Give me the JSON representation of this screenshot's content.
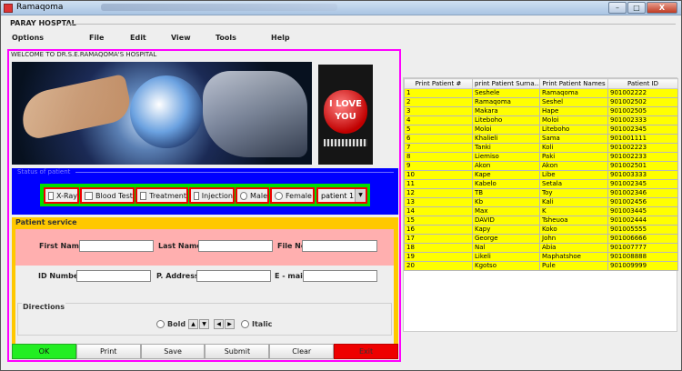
{
  "window": {
    "title": "Ramaqoma",
    "buttons": {
      "minimize": "–",
      "maximize": "□",
      "close": "X"
    }
  },
  "frame": {
    "title": "PARAY HOSPTAL"
  },
  "menu": [
    "Options",
    "File",
    "Edit",
    "View",
    "Tools",
    "Help"
  ],
  "welcome": "WELCOME TO DR.S.E.RAMAQOMA'S HOSPITAL",
  "banner": {
    "heart_top": "I LOVE",
    "heart_bottom": "YOU"
  },
  "status": {
    "legend": "Status of patient",
    "options": [
      {
        "kind": "checkbox",
        "label": "X-Ray"
      },
      {
        "kind": "checkbox",
        "label": "Blood Test"
      },
      {
        "kind": "checkbox",
        "label": "Treatment"
      },
      {
        "kind": "checkbox",
        "label": "Injection"
      },
      {
        "kind": "radio",
        "label": "Male"
      },
      {
        "kind": "radio",
        "label": "Female"
      }
    ],
    "combo_value": "patient 1"
  },
  "service": {
    "title": "Patient service",
    "labels": {
      "first_name": "First Name",
      "last_name": "Last Name",
      "file_no": "File No",
      "id_number": "ID Number",
      "p_address": "P. Address",
      "email": "E - mail"
    },
    "directions": {
      "label": "Directions",
      "bold": "Bold",
      "italic": "Italic"
    }
  },
  "buttons": [
    "OK",
    "Print",
    "Save",
    "Submit",
    "Clear",
    "Exit"
  ],
  "table": {
    "headers": [
      "Print Patient #",
      "print Patient Surna...",
      "Print Patient Names",
      "Patient ID"
    ],
    "rows": [
      [
        "1",
        "Seshele",
        "Ramaqoma",
        "901002222"
      ],
      [
        "2",
        "Ramaqoma",
        "Seshel",
        "901002502"
      ],
      [
        "3",
        "Makara",
        "Hape",
        "901002505"
      ],
      [
        "4",
        "Liteboho",
        "Moloi",
        "901002333"
      ],
      [
        "5",
        "Moloi",
        "Liteboho",
        "901002345"
      ],
      [
        "6",
        "Khalieli",
        "Sama",
        "901001111"
      ],
      [
        "7",
        "Tanki",
        "Koli",
        "901002223"
      ],
      [
        "8",
        "Liemiso",
        "Paki",
        "901002233"
      ],
      [
        "9",
        "Akon",
        "Akon",
        "901002501"
      ],
      [
        "10",
        "Kape",
        "Libe",
        "901003333"
      ],
      [
        "11",
        "Kabelo",
        "Setala",
        "901002345"
      ],
      [
        "12",
        "TB",
        "Toy",
        "901002346"
      ],
      [
        "13",
        "Kb",
        "Kali",
        "901002456"
      ],
      [
        "14",
        "Max",
        "K",
        "901003445"
      ],
      [
        "15",
        "DAVID",
        "Tsheuoa",
        "901002444"
      ],
      [
        "16",
        "Kapy",
        "Koko",
        "901005555"
      ],
      [
        "17",
        "George",
        "John",
        "901006666"
      ],
      [
        "18",
        "Nal",
        "Abia",
        "901007777"
      ],
      [
        "19",
        "Likeli",
        "Maphatshoe",
        "901008888"
      ],
      [
        "20",
        "Kgotso",
        "Pule",
        "901009999"
      ]
    ]
  }
}
